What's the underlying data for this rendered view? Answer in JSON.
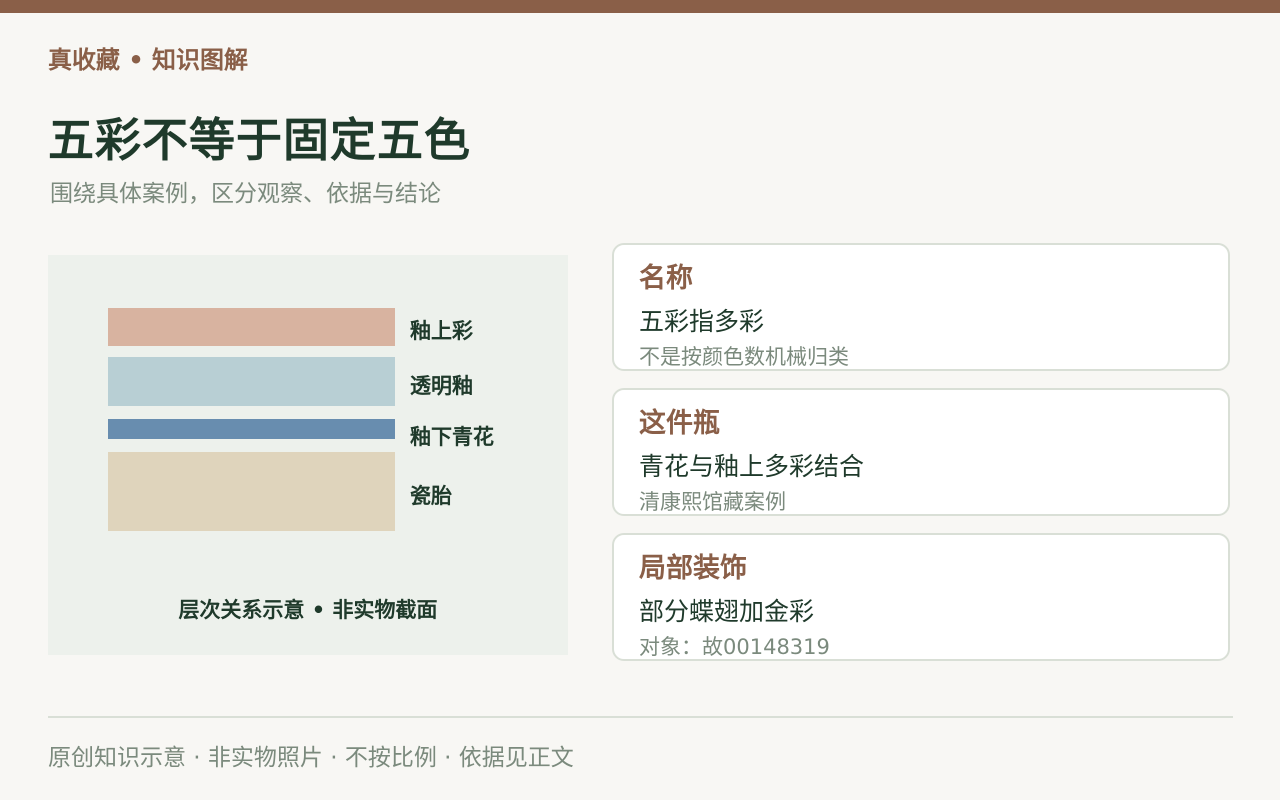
{
  "colors": {
    "top_bar": "#8a5f48",
    "brand": "#8a5f48",
    "title": "#1f3a2b",
    "subtitle": "#7b8a7d",
    "panel_bg": "#edf1ec",
    "layer_label": "#1f3a2b",
    "card_title": "#8a5f48",
    "card_body": "#1f3a2b",
    "card_note": "#7b8a7d",
    "divider": "#d9dfd6",
    "footer": "#7b8a7d"
  },
  "header": {
    "brand": "真收藏 • 知识图解",
    "title": "五彩不等于固定五色",
    "subtitle": "围绕具体案例，区分观察、依据与结论"
  },
  "diagram": {
    "layers": [
      {
        "label": "釉上彩",
        "color": "#d8b3a0"
      },
      {
        "label": "透明釉",
        "color": "#b8cfd4"
      },
      {
        "label": "釉下青花",
        "color": "#688daf"
      },
      {
        "label": "瓷胎",
        "color": "#dfd4bc"
      }
    ],
    "caption": "层次关系示意 • 非实物截面"
  },
  "cards": [
    {
      "title": "名称",
      "body": "五彩指多彩",
      "note": "不是按颜色数机械归类"
    },
    {
      "title": "这件瓶",
      "body": "青花与釉上多彩结合",
      "note": "清康熙馆藏案例"
    },
    {
      "title": "局部装饰",
      "body": "部分蝶翅加金彩",
      "note": "对象：故00148319"
    }
  ],
  "footer": "原创知识示意 · 非实物照片 · 不按比例 · 依据见正文"
}
